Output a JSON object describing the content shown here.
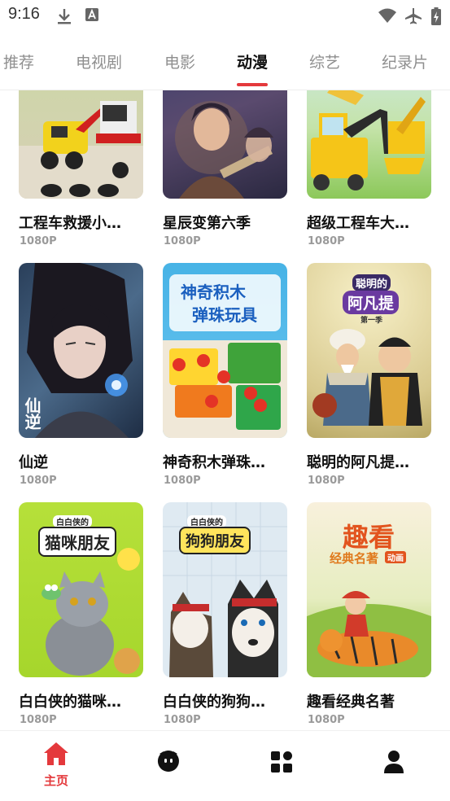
{
  "status_bar": {
    "time": "9:16"
  },
  "tabs": [
    {
      "label": "推荐"
    },
    {
      "label": "电视剧"
    },
    {
      "label": "电影"
    },
    {
      "label": "动漫",
      "active": true
    },
    {
      "label": "综艺"
    },
    {
      "label": "纪录片"
    }
  ],
  "cards": [
    {
      "title": "工程车救援小…",
      "quality": "1080P"
    },
    {
      "title": "星辰变第六季",
      "quality": "1080P"
    },
    {
      "title": "超级工程车大…",
      "quality": "1080P"
    },
    {
      "title": "仙逆",
      "quality": "1080P",
      "poster_text": "仙逆"
    },
    {
      "title": "神奇积木弹珠…",
      "quality": "1080P",
      "poster_text": [
        "神奇积木",
        "弹珠玩具"
      ]
    },
    {
      "title": "聪明的阿凡提…",
      "quality": "1080P",
      "poster_text": [
        "聪明的",
        "阿凡提",
        "第一季"
      ]
    },
    {
      "title": "白白侠的猫咪…",
      "quality": "1080P",
      "poster_text": [
        "白白侠的",
        "猫咪朋友"
      ]
    },
    {
      "title": "白白侠的狗狗…",
      "quality": "1080P",
      "poster_text": [
        "白白侠的",
        "狗狗朋友"
      ]
    },
    {
      "title": "趣看经典名著",
      "quality": "1080P",
      "poster_text": [
        "趣看",
        "经典名著",
        "动画"
      ]
    }
  ],
  "bottom_nav": [
    {
      "icon": "home-icon",
      "label": "主页",
      "active": true
    },
    {
      "icon": "face-icon"
    },
    {
      "icon": "grid-icon"
    },
    {
      "icon": "user-icon"
    }
  ],
  "colors": {
    "accent": "#e4393c",
    "inactive_tab": "#8f8f8f",
    "quality": "#9a9a9a"
  }
}
